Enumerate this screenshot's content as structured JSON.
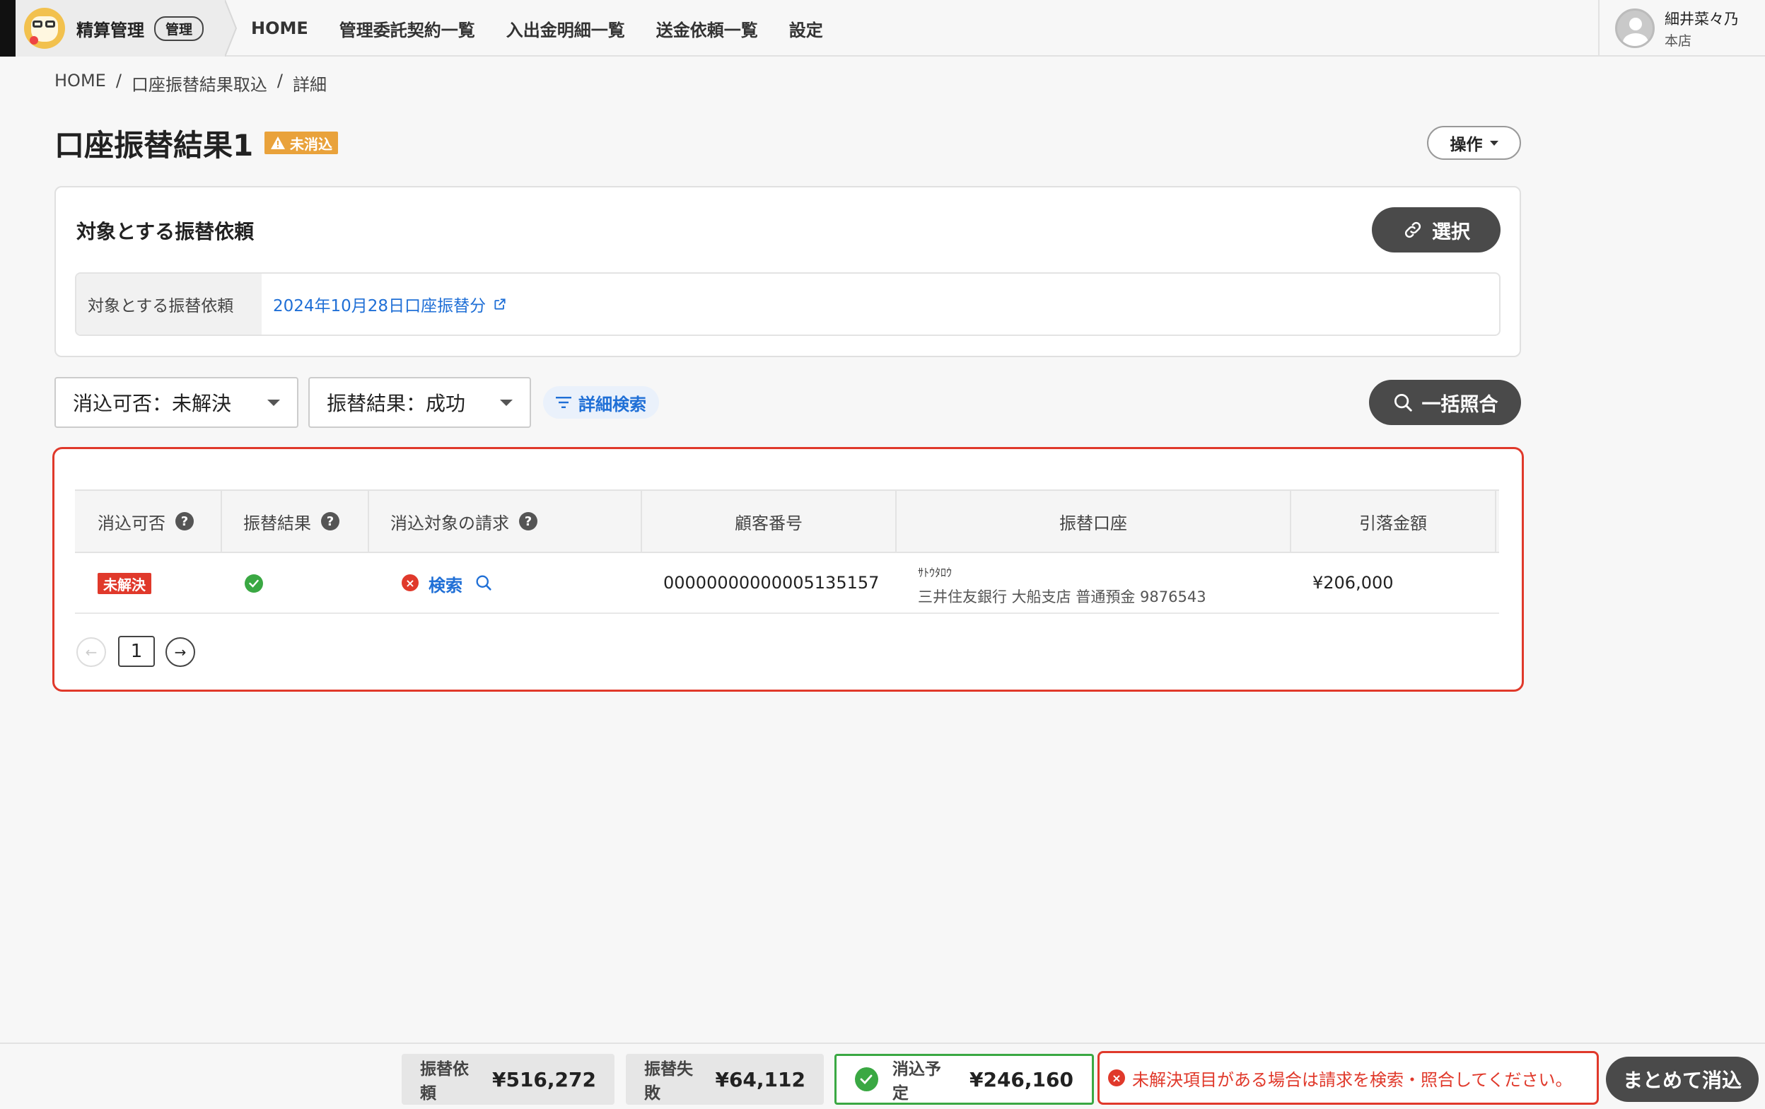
{
  "app": {
    "brand_title": "精算管理",
    "brand_badge": "管理",
    "nav": [
      "HOME",
      "管理委託契約一覧",
      "入出金明細一覧",
      "送金依頼一覧",
      "設定"
    ],
    "user": {
      "name": "細井菜々乃",
      "branch": "本店"
    }
  },
  "breadcrumb": [
    "HOME",
    "/",
    "口座振替結果取込",
    "/",
    "詳細"
  ],
  "page": {
    "title": "口座振替結果1",
    "status_badge": "未消込",
    "ops_label": "操作"
  },
  "target_card": {
    "title": "対象とする振替依頼",
    "select_label": "選択",
    "row_label": "対象とする振替依頼",
    "row_value": "2024年10月28日口座振替分"
  },
  "filters": {
    "reconcile": "消込可否：未解決",
    "result": "振替結果：成功",
    "advanced_search": "詳細検索",
    "bulk_match": "一括照合"
  },
  "table": {
    "headers": [
      "消込可否",
      "振替結果",
      "消込対象の請求",
      "顧客番号",
      "振替口座",
      "引落金額"
    ],
    "rows": [
      {
        "reconcile_status": "未解決",
        "target_action": "検索",
        "customer_no": "00000000000005135157",
        "account_kana": "ｻﾄｳﾀﾛｳ",
        "account_bank": "三井住友銀行 大船支店 普通預金 9876543",
        "amount": "¥206,000"
      }
    ],
    "pager": {
      "prev": "←",
      "page": "1",
      "next": "→"
    }
  },
  "bottom": {
    "transfer_request_label": "振替依頼",
    "transfer_request_value": "¥516,272",
    "transfer_failed_label": "振替失敗",
    "transfer_failed_value": "¥64,112",
    "scheduled_label": "消込予定",
    "scheduled_value": "¥246,160",
    "warning": "未解決項目がある場合は請求を検索・照合してください。",
    "batch_button": "まとめて消込"
  },
  "colors": {
    "accent_dark": "#4a4a4a",
    "link": "#1f6fd6",
    "error": "#e0392b",
    "success": "#3aa843",
    "warning": "#e9a23b"
  }
}
